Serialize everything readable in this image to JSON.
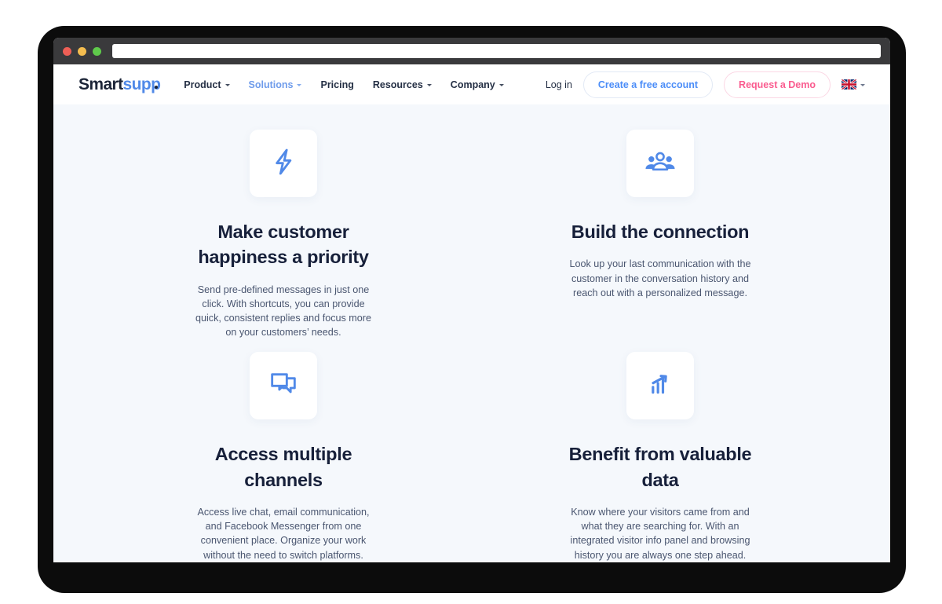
{
  "browser": {
    "url_value": "",
    "url_placeholder": "",
    "traffic_lights": [
      "close",
      "minimize",
      "maximize"
    ]
  },
  "navbar": {
    "logo": {
      "part1": "Smart",
      "part2": "supp"
    },
    "links": [
      {
        "label": "Product",
        "has_caret": true,
        "active": false
      },
      {
        "label": "Solutions",
        "has_caret": true,
        "active": true
      },
      {
        "label": "Pricing",
        "has_caret": false,
        "active": false
      },
      {
        "label": "Resources",
        "has_caret": true,
        "active": false
      },
      {
        "label": "Company",
        "has_caret": true,
        "active": false
      }
    ],
    "login_label": "Log in",
    "signup_label": "Create a free account",
    "demo_label": "Request a Demo",
    "language": {
      "flag": "uk-flag-icon",
      "code": "EN"
    }
  },
  "colors": {
    "page_bg": "#f5f8fc",
    "icon_blue": "#5089e8",
    "accent_blue": "#4b8df8",
    "accent_pink": "#fa5c8f",
    "heading": "#17203a",
    "body_text": "#4a5670",
    "chrome": "#3a3a3c",
    "frame": "#0c0c0c"
  },
  "cards": [
    {
      "icon": "lightning-bolt-icon",
      "title": "Make customer happiness a priority",
      "body": "Send pre-defined messages in just one click. With shortcuts, you can provide quick, consistent replies and focus more on your customers’ needs."
    },
    {
      "icon": "people-group-icon",
      "title": "Build the connection",
      "body": "Look up your last communication with the customer in the conversation history and reach out with a personalized message."
    },
    {
      "icon": "chat-bubbles-icon",
      "title": "Access multiple channels",
      "body": "Access live chat, email communication, and Facebook Messenger from one convenient place. Organize your work without the need to switch platforms."
    },
    {
      "icon": "bar-chart-arrow-icon",
      "title": "Benefit from valuable data",
      "body": "Know where your visitors came from and what they are searching for. With an integrated visitor info panel and browsing history you are always one step ahead."
    }
  ]
}
